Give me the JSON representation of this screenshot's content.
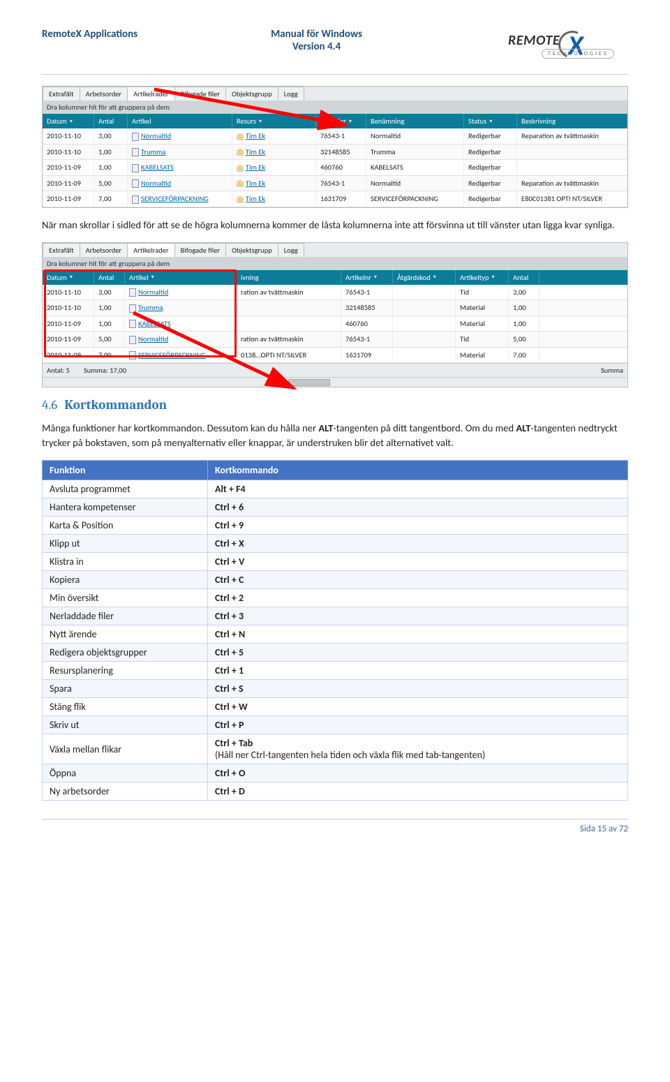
{
  "header": {
    "left": "RemoteX Applications",
    "center_line1": "Manual för Windows",
    "center_line2": "Version 4.4",
    "logo_main": "REMOTE",
    "logo_x": "X",
    "logo_sub": "TECHNOLOGIES"
  },
  "screenshot1": {
    "tabs": [
      "Extrafält",
      "Arbetsorder",
      "Artikelrader",
      "Bifogade filer",
      "Objektsgrupp",
      "Logg"
    ],
    "active_tab_index": 2,
    "group_hint": "Dra kolumner hit för att gruppera på dem",
    "columns": [
      {
        "label": "Datum",
        "filter": true,
        "cls": "w-date"
      },
      {
        "label": "Antal",
        "filter": false,
        "cls": "w-ant"
      },
      {
        "label": "Artikel",
        "filter": false,
        "cls": "w-art"
      },
      {
        "label": "Resurs",
        "filter": true,
        "cls": "w-res"
      },
      {
        "label": "Artikelnr",
        "filter": true,
        "cls": "w-anr"
      },
      {
        "label": "Benämning",
        "filter": false,
        "cls": "w-ben"
      },
      {
        "label": "Status",
        "filter": true,
        "cls": "w-stat"
      },
      {
        "label": "Beskrivning",
        "filter": false,
        "cls": "w-besk"
      }
    ],
    "rows": [
      {
        "date": "2010-11-10",
        "qty": "3,00",
        "article": "Normaltid",
        "resource": "Tim Ek",
        "anr": "76543-1",
        "ben": "Normaltid",
        "status": "Redigerbar",
        "besk": "Reparation av tvättmaskin"
      },
      {
        "date": "2010-11-10",
        "qty": "1,00",
        "article": "Trumma",
        "resource": "Tim Ek",
        "anr": "32148585",
        "ben": "Trumma",
        "status": "Redigerbar",
        "besk": ""
      },
      {
        "date": "2010-11-09",
        "qty": "1,00",
        "article": "KABELSATS",
        "resource": "Tim Ek",
        "anr": "460760",
        "ben": "KABELSATS",
        "status": "Redigerbar",
        "besk": ""
      },
      {
        "date": "2010-11-09",
        "qty": "5,00",
        "article": "Normaltid",
        "resource": "Tim Ek",
        "anr": "76543-1",
        "ben": "Normaltid",
        "status": "Redigerbar",
        "besk": "Reparation av tvättmaskin"
      },
      {
        "date": "2010-11-09",
        "qty": "7,00",
        "article": "SERVICEFÖRPACKNING",
        "resource": "Tim Ek",
        "anr": "1631709",
        "ben": "SERVICEFÖRPACKNING",
        "status": "Redigerbar",
        "besk": "E80C01381 OPTI NT/SILVER"
      }
    ]
  },
  "paragraph1": "När man skrollar i sidled för att se de högra kolumnerna kommer de låsta kolumnerna inte att försvinna ut till vänster utan ligga kvar synliga.",
  "screenshot2": {
    "tabs": [
      "Extrafält",
      "Arbetsorder",
      "Artikelrader",
      "Bifogade filer",
      "Objektsgrupp",
      "Logg"
    ],
    "active_tab_index": 2,
    "group_hint": "Dra kolumner hit för att gruppera på dem",
    "columns": [
      {
        "label": "Datum",
        "filter": true,
        "cls": "w2-date"
      },
      {
        "label": "Antal",
        "filter": false,
        "cls": "w2-ant"
      },
      {
        "label": "Artikel",
        "filter": true,
        "cls": "w2-art"
      },
      {
        "label": "ivning",
        "filter": false,
        "cls": "w2-ivn"
      },
      {
        "label": "Artikelnr",
        "filter": true,
        "cls": "w2-anr"
      },
      {
        "label": "Åtgärdskod",
        "filter": true,
        "cls": "w2-atg"
      },
      {
        "label": "Artikeltyp",
        "filter": true,
        "cls": "w2-atyp"
      },
      {
        "label": "Antal",
        "filter": false,
        "cls": "w2-ant2"
      }
    ],
    "rows": [
      {
        "c": [
          "2010-11-10",
          "3,00",
          "Normaltid",
          "ration av tvättmaskin",
          "76543-1",
          "",
          "Tid",
          "3,00"
        ],
        "link": 2
      },
      {
        "c": [
          "2010-11-10",
          "1,00",
          "Trumma",
          "",
          "32148585",
          "",
          "Material",
          "1,00"
        ],
        "link": 2
      },
      {
        "c": [
          "2010-11-09",
          "1,00",
          "KABELSATS",
          "",
          "460760",
          "",
          "Material",
          "1,00"
        ],
        "link": 2
      },
      {
        "c": [
          "2010-11-09",
          "5,00",
          "Normaltid",
          "ration av tvättmaskin",
          "76543-1",
          "",
          "Tid",
          "5,00"
        ],
        "link": 2
      },
      {
        "c": [
          "2010-11-09",
          "7,00",
          "SERVICEFÖRPACKNING",
          "0138…OPTI NT/SILVER",
          "1631709",
          "",
          "Material",
          "7,00"
        ],
        "link": 2
      }
    ],
    "footer": {
      "count_label": "Antal: 5",
      "sum_label": "Summa: 17,00",
      "sum_right": "Summa"
    }
  },
  "section": {
    "number": "4.6",
    "title": "Kortkommandon",
    "text1": "Många funktioner har kortkommandon. Dessutom kan du hålla ner ",
    "bold1": "ALT",
    "text2": "-tangenten på ditt tangentbord. Om du med ",
    "bold2": "ALT",
    "text3": "-tangenten nedtryckt trycker på bokstaven, som på menyalternativ eller knappar, är understruken blir det alternativet valt."
  },
  "shortcuts": {
    "header_left": "Funktion",
    "header_right": "Kortkommando",
    "rows": [
      {
        "f": "Avsluta programmet",
        "k": "Alt + F4"
      },
      {
        "f": "Hantera kompetenser",
        "k": "Ctrl + 6"
      },
      {
        "f": "Karta & Position",
        "k": "Ctrl + 9"
      },
      {
        "f": "Klipp ut",
        "k": "Ctrl + X"
      },
      {
        "f": "Klistra in",
        "k": "Ctrl + V"
      },
      {
        "f": "Kopiera",
        "k": "Ctrl + C"
      },
      {
        "f": "Min översikt",
        "k": "Ctrl + 2"
      },
      {
        "f": "Nerladdade filer",
        "k": "Ctrl + 3"
      },
      {
        "f": "Nytt ärende",
        "k": "Ctrl + N"
      },
      {
        "f": "Redigera objektsgrupper",
        "k": "Ctrl + 5"
      },
      {
        "f": "Resursplanering",
        "k": "Ctrl + 1"
      },
      {
        "f": "Spara",
        "k": "Ctrl + S"
      },
      {
        "f": "Stäng flik",
        "k": "Ctrl + W"
      },
      {
        "f": "Skriv ut",
        "k": "Ctrl + P"
      },
      {
        "f": "Växla mellan flikar",
        "k": "Ctrl + Tab",
        "note": "(Håll ner Ctrl-tangenten hela tiden och växla flik med tab-tangenten)"
      },
      {
        "f": "Öppna",
        "k": "Ctrl + O"
      },
      {
        "f": "Ny arbetsorder",
        "k": "Ctrl + D"
      }
    ]
  },
  "footer": {
    "text": "Sida 15 av 72"
  }
}
